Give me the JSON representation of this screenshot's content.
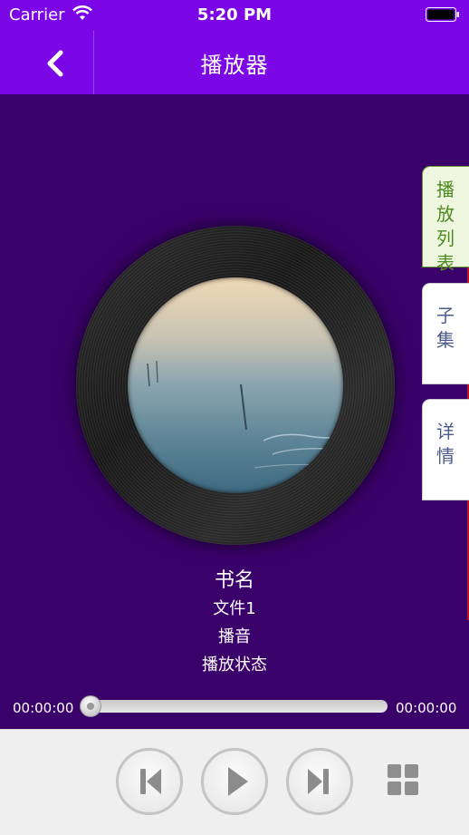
{
  "status_bar": {
    "carrier": "Carrier",
    "time": "5:20 PM"
  },
  "nav": {
    "title": "播放器"
  },
  "side_tabs": [
    {
      "label": "播\n放\n列\n表",
      "active": true
    },
    {
      "label": "子\n集",
      "active": false
    },
    {
      "label": "详\n情",
      "active": false
    }
  ],
  "track_info": {
    "book_title": "书名",
    "file_name": "文件1",
    "narrator": "播音",
    "play_state": "播放状态"
  },
  "progress": {
    "elapsed": "00:00:00",
    "total": "00:00:00",
    "fraction": 0.0
  },
  "icons": {
    "back": "chevron-left-icon",
    "prev": "skip-previous-icon",
    "play": "play-icon",
    "next": "skip-next-icon",
    "grid": "grid-icon"
  },
  "colors": {
    "nav_bar": "#7b06e6",
    "background": "#3b016b",
    "active_tab_text": "#4d8a1e",
    "tab_text": "#4b5b8c"
  }
}
